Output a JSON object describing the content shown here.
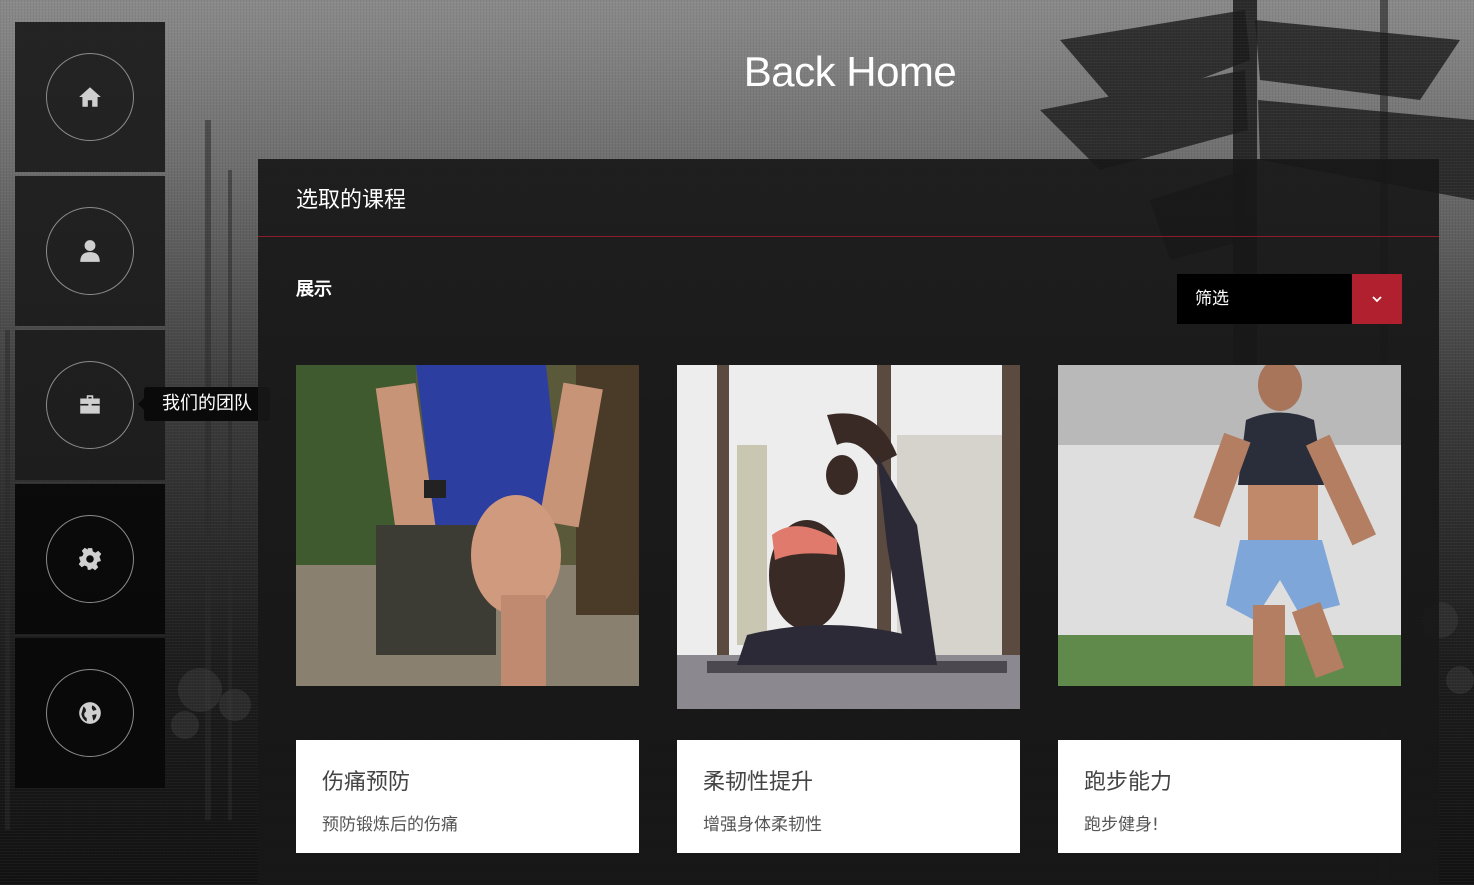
{
  "page": {
    "title": "Back Home"
  },
  "sidebar": {
    "items": [
      {
        "name": "home",
        "icon": "home-icon"
      },
      {
        "name": "user",
        "icon": "user-icon"
      },
      {
        "name": "team",
        "icon": "briefcase-icon"
      },
      {
        "name": "settings",
        "icon": "gear-icon"
      },
      {
        "name": "globe",
        "icon": "globe-icon"
      }
    ],
    "tooltip": "我们的团队"
  },
  "panel": {
    "header": "选取的课程",
    "show_label": "展示",
    "filter": {
      "value": "筛选"
    }
  },
  "cards": [
    {
      "title": "伤痛预防",
      "desc": "预防锻炼后的伤痛"
    },
    {
      "title": "柔韧性提升",
      "desc": "增强身体柔韧性"
    },
    {
      "title": "跑步能力",
      "desc": "跑步健身!"
    }
  ],
  "colors": {
    "accent": "#b0202f",
    "panel": "#181818",
    "divider": "#8b1c2a"
  }
}
